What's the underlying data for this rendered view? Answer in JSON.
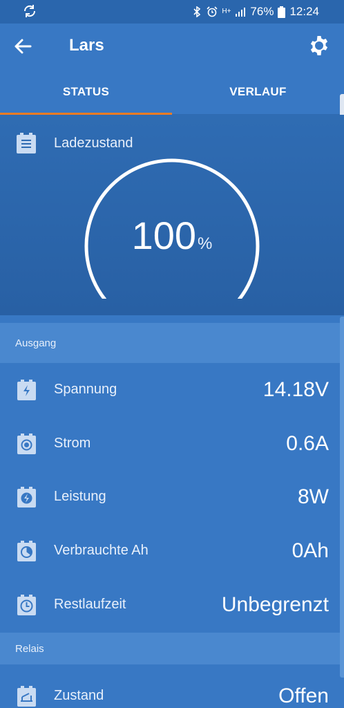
{
  "statusbar": {
    "battery_percent": "76%",
    "time": "12:24",
    "network": "H+"
  },
  "appbar": {
    "title": "Lars"
  },
  "tabs": [
    {
      "label": "STATUS",
      "active": true
    },
    {
      "label": "VERLAUF",
      "active": false
    }
  ],
  "gauge": {
    "label": "Ladezustand",
    "value": "100",
    "unit": "%",
    "fraction": 1.0
  },
  "sections": {
    "ausgang": "Ausgang",
    "relais": "Relais"
  },
  "rows": [
    {
      "label": "Spannung",
      "value": "14.18V",
      "icon": "battery-charge-icon"
    },
    {
      "label": "Strom",
      "value": "0.6A",
      "icon": "battery-current-icon"
    },
    {
      "label": "Leistung",
      "value": "8W",
      "icon": "battery-power-icon"
    },
    {
      "label": "Verbrauchte Ah",
      "value": "0Ah",
      "icon": "battery-consumed-icon"
    },
    {
      "label": "Restlaufzeit",
      "value": "Unbegrenzt",
      "icon": "battery-clock-icon"
    },
    {
      "label": "Zustand",
      "value": "Offen",
      "icon": "relay-icon"
    }
  ],
  "colors": {
    "background": "#3878c4",
    "section_header": "#4a88cf",
    "gauge_bg": "#2d66ab",
    "tab_indicator": "#f07c24"
  }
}
